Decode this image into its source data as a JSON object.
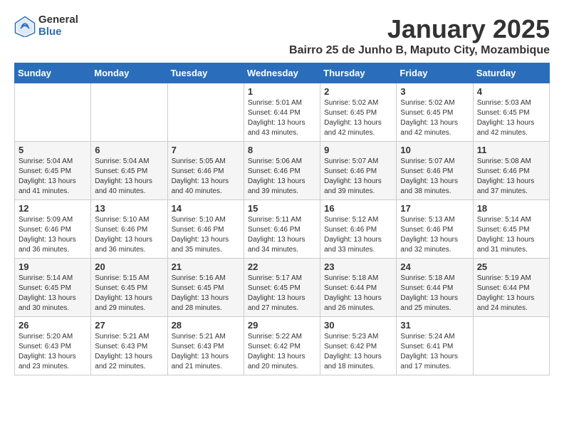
{
  "logo": {
    "general": "General",
    "blue": "Blue"
  },
  "title": "January 2025",
  "location": "Bairro 25 de Junho B, Maputo City, Mozambique",
  "weekdays": [
    "Sunday",
    "Monday",
    "Tuesday",
    "Wednesday",
    "Thursday",
    "Friday",
    "Saturday"
  ],
  "weeks": [
    [
      {
        "day": "",
        "sunrise": "",
        "sunset": "",
        "daylight": ""
      },
      {
        "day": "",
        "sunrise": "",
        "sunset": "",
        "daylight": ""
      },
      {
        "day": "",
        "sunrise": "",
        "sunset": "",
        "daylight": ""
      },
      {
        "day": "1",
        "sunrise": "Sunrise: 5:01 AM",
        "sunset": "Sunset: 6:44 PM",
        "daylight": "Daylight: 13 hours and 43 minutes."
      },
      {
        "day": "2",
        "sunrise": "Sunrise: 5:02 AM",
        "sunset": "Sunset: 6:45 PM",
        "daylight": "Daylight: 13 hours and 42 minutes."
      },
      {
        "day": "3",
        "sunrise": "Sunrise: 5:02 AM",
        "sunset": "Sunset: 6:45 PM",
        "daylight": "Daylight: 13 hours and 42 minutes."
      },
      {
        "day": "4",
        "sunrise": "Sunrise: 5:03 AM",
        "sunset": "Sunset: 6:45 PM",
        "daylight": "Daylight: 13 hours and 42 minutes."
      }
    ],
    [
      {
        "day": "5",
        "sunrise": "Sunrise: 5:04 AM",
        "sunset": "Sunset: 6:45 PM",
        "daylight": "Daylight: 13 hours and 41 minutes."
      },
      {
        "day": "6",
        "sunrise": "Sunrise: 5:04 AM",
        "sunset": "Sunset: 6:45 PM",
        "daylight": "Daylight: 13 hours and 40 minutes."
      },
      {
        "day": "7",
        "sunrise": "Sunrise: 5:05 AM",
        "sunset": "Sunset: 6:46 PM",
        "daylight": "Daylight: 13 hours and 40 minutes."
      },
      {
        "day": "8",
        "sunrise": "Sunrise: 5:06 AM",
        "sunset": "Sunset: 6:46 PM",
        "daylight": "Daylight: 13 hours and 39 minutes."
      },
      {
        "day": "9",
        "sunrise": "Sunrise: 5:07 AM",
        "sunset": "Sunset: 6:46 PM",
        "daylight": "Daylight: 13 hours and 39 minutes."
      },
      {
        "day": "10",
        "sunrise": "Sunrise: 5:07 AM",
        "sunset": "Sunset: 6:46 PM",
        "daylight": "Daylight: 13 hours and 38 minutes."
      },
      {
        "day": "11",
        "sunrise": "Sunrise: 5:08 AM",
        "sunset": "Sunset: 6:46 PM",
        "daylight": "Daylight: 13 hours and 37 minutes."
      }
    ],
    [
      {
        "day": "12",
        "sunrise": "Sunrise: 5:09 AM",
        "sunset": "Sunset: 6:46 PM",
        "daylight": "Daylight: 13 hours and 36 minutes."
      },
      {
        "day": "13",
        "sunrise": "Sunrise: 5:10 AM",
        "sunset": "Sunset: 6:46 PM",
        "daylight": "Daylight: 13 hours and 36 minutes."
      },
      {
        "day": "14",
        "sunrise": "Sunrise: 5:10 AM",
        "sunset": "Sunset: 6:46 PM",
        "daylight": "Daylight: 13 hours and 35 minutes."
      },
      {
        "day": "15",
        "sunrise": "Sunrise: 5:11 AM",
        "sunset": "Sunset: 6:46 PM",
        "daylight": "Daylight: 13 hours and 34 minutes."
      },
      {
        "day": "16",
        "sunrise": "Sunrise: 5:12 AM",
        "sunset": "Sunset: 6:46 PM",
        "daylight": "Daylight: 13 hours and 33 minutes."
      },
      {
        "day": "17",
        "sunrise": "Sunrise: 5:13 AM",
        "sunset": "Sunset: 6:46 PM",
        "daylight": "Daylight: 13 hours and 32 minutes."
      },
      {
        "day": "18",
        "sunrise": "Sunrise: 5:14 AM",
        "sunset": "Sunset: 6:45 PM",
        "daylight": "Daylight: 13 hours and 31 minutes."
      }
    ],
    [
      {
        "day": "19",
        "sunrise": "Sunrise: 5:14 AM",
        "sunset": "Sunset: 6:45 PM",
        "daylight": "Daylight: 13 hours and 30 minutes."
      },
      {
        "day": "20",
        "sunrise": "Sunrise: 5:15 AM",
        "sunset": "Sunset: 6:45 PM",
        "daylight": "Daylight: 13 hours and 29 minutes."
      },
      {
        "day": "21",
        "sunrise": "Sunrise: 5:16 AM",
        "sunset": "Sunset: 6:45 PM",
        "daylight": "Daylight: 13 hours and 28 minutes."
      },
      {
        "day": "22",
        "sunrise": "Sunrise: 5:17 AM",
        "sunset": "Sunset: 6:45 PM",
        "daylight": "Daylight: 13 hours and 27 minutes."
      },
      {
        "day": "23",
        "sunrise": "Sunrise: 5:18 AM",
        "sunset": "Sunset: 6:44 PM",
        "daylight": "Daylight: 13 hours and 26 minutes."
      },
      {
        "day": "24",
        "sunrise": "Sunrise: 5:18 AM",
        "sunset": "Sunset: 6:44 PM",
        "daylight": "Daylight: 13 hours and 25 minutes."
      },
      {
        "day": "25",
        "sunrise": "Sunrise: 5:19 AM",
        "sunset": "Sunset: 6:44 PM",
        "daylight": "Daylight: 13 hours and 24 minutes."
      }
    ],
    [
      {
        "day": "26",
        "sunrise": "Sunrise: 5:20 AM",
        "sunset": "Sunset: 6:43 PM",
        "daylight": "Daylight: 13 hours and 23 minutes."
      },
      {
        "day": "27",
        "sunrise": "Sunrise: 5:21 AM",
        "sunset": "Sunset: 6:43 PM",
        "daylight": "Daylight: 13 hours and 22 minutes."
      },
      {
        "day": "28",
        "sunrise": "Sunrise: 5:21 AM",
        "sunset": "Sunset: 6:43 PM",
        "daylight": "Daylight: 13 hours and 21 minutes."
      },
      {
        "day": "29",
        "sunrise": "Sunrise: 5:22 AM",
        "sunset": "Sunset: 6:42 PM",
        "daylight": "Daylight: 13 hours and 20 minutes."
      },
      {
        "day": "30",
        "sunrise": "Sunrise: 5:23 AM",
        "sunset": "Sunset: 6:42 PM",
        "daylight": "Daylight: 13 hours and 18 minutes."
      },
      {
        "day": "31",
        "sunrise": "Sunrise: 5:24 AM",
        "sunset": "Sunset: 6:41 PM",
        "daylight": "Daylight: 13 hours and 17 minutes."
      },
      {
        "day": "",
        "sunrise": "",
        "sunset": "",
        "daylight": ""
      }
    ]
  ]
}
